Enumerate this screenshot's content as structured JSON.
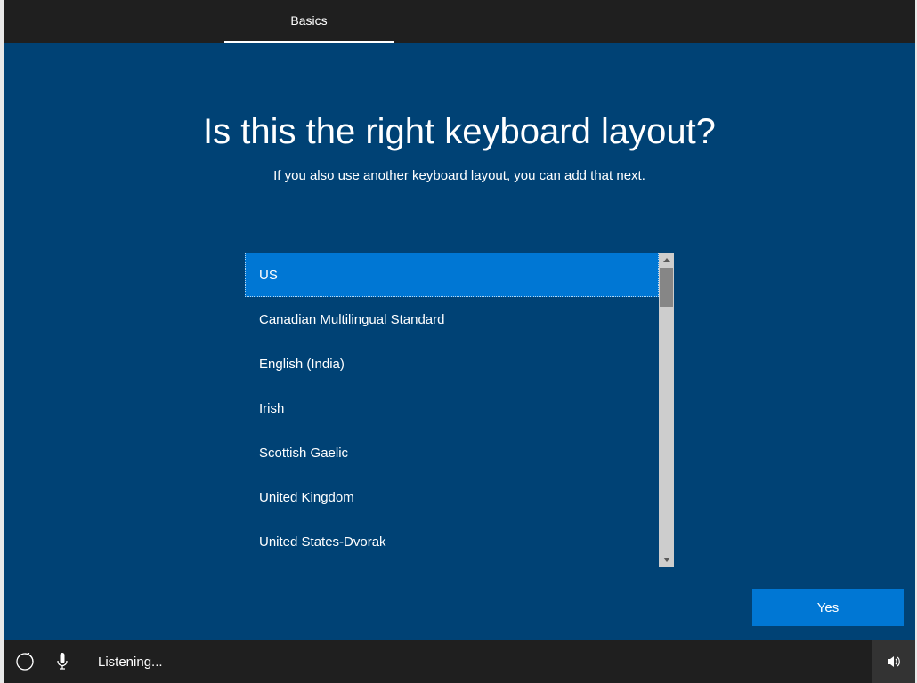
{
  "tabs": {
    "basics": "Basics"
  },
  "title": "Is this the right keyboard layout?",
  "subtitle": "If you also use another keyboard layout, you can add that next.",
  "layouts": [
    {
      "label": "US",
      "selected": true
    },
    {
      "label": "Canadian Multilingual Standard",
      "selected": false
    },
    {
      "label": "English (India)",
      "selected": false
    },
    {
      "label": "Irish",
      "selected": false
    },
    {
      "label": "Scottish Gaelic",
      "selected": false
    },
    {
      "label": "United Kingdom",
      "selected": false
    },
    {
      "label": "United States-Dvorak",
      "selected": false
    }
  ],
  "buttons": {
    "yes": "Yes"
  },
  "bottom": {
    "listening": "Listening..."
  }
}
